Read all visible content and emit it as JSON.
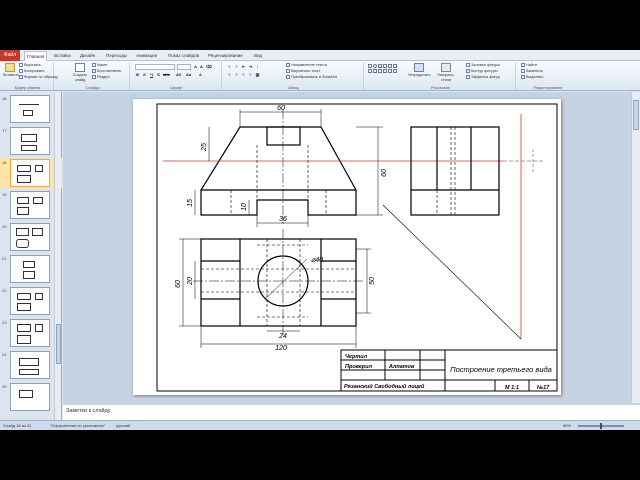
{
  "app": {
    "file_tab": "Файл",
    "tabs": [
      "Главная",
      "Вставка",
      "Дизайн",
      "Переходы",
      "Анимация",
      "Показ слайдов",
      "Рецензирование",
      "Вид"
    ]
  },
  "ribbon": {
    "clipboard": {
      "title": "Буфер обмена",
      "paste": "Вставить",
      "cut": "Вырезать",
      "copy": "Копировать",
      "format_painter": "Формат по образцу"
    },
    "slides": {
      "title": "Слайды",
      "new_slide": "Создать слайд",
      "layout": "Макет",
      "reset": "Восстановить",
      "section": "Раздел"
    },
    "font": {
      "title": "Шрифт"
    },
    "paragraph": {
      "title": "Абзац",
      "text_direction": "Направление текста",
      "align_text": "Выровнять текст",
      "smartart": "Преобразовать в SmartArt"
    },
    "drawing": {
      "title": "Рисование",
      "arrange": "Упорядочить",
      "quick_styles": "Экспресс-стили",
      "shape_fill": "Заливка фигуры",
      "shape_outline": "Контур фигуры",
      "shape_effects": "Эффекты фигур"
    },
    "editing": {
      "title": "Редактирование",
      "find": "Найти",
      "replace": "Заменить",
      "select": "Выделить"
    }
  },
  "slide_panel": {
    "numbers": [
      "16",
      "17",
      "18",
      "19",
      "20",
      "21",
      "22",
      "23",
      "24",
      "25"
    ],
    "selected": "18"
  },
  "drawing": {
    "dims": {
      "top_width": "60",
      "top_height": "25",
      "left_height": "15",
      "total_height": "60",
      "slot_height": "10",
      "slot_width": "36",
      "circle_dia": "⌀40",
      "plan_left_dim": "60",
      "plan_inner_dim": "20",
      "plan_right_dim": "50",
      "plan_small_width": "24",
      "plan_total_width": "120"
    },
    "title_block": {
      "drew_label": "Чертил",
      "checked_label": "Проверил",
      "checker_name": "Алпатов",
      "school": "Рязанский Свободный лицей",
      "drawing_title": "Построение третьего вида",
      "scale": "М 1:1",
      "number": "№17"
    }
  },
  "notes": {
    "placeholder": "Заметки к слайду"
  },
  "status": {
    "slide_counter": "Слайд 18 из 31",
    "theme": "\"Оформление по умолчанию\"",
    "language": "русский",
    "zoom": "65%"
  },
  "colors": {
    "file_tab": "#c13b2a",
    "axis_line": "#e0302a",
    "selection": "#f0a73c"
  }
}
